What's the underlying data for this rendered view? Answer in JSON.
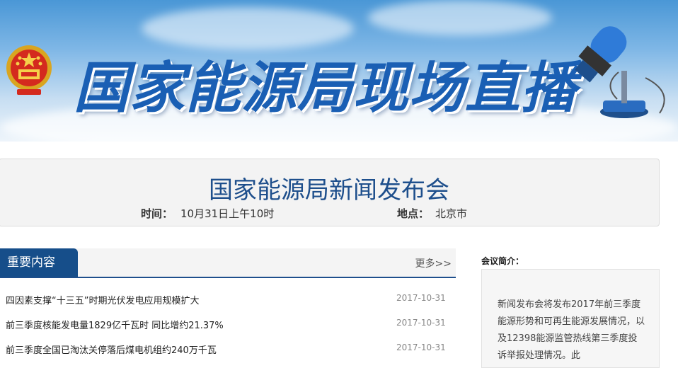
{
  "banner": {
    "title": "国家能源局现场直播",
    "emblem_icon": "national-emblem-icon",
    "mic_icon": "microphone-icon"
  },
  "press": {
    "title": "国家能源局新闻发布会",
    "time_label": "时间：",
    "time_value": "10月31日上午10时",
    "place_label": "地点：",
    "place_value": "北京市"
  },
  "key": {
    "tab_label": "重要内容",
    "more_label": "更多>>",
    "items": [
      {
        "title": "四因素支撑“十三五”时期光伏发电应用规模扩大",
        "date": "2017-10-31"
      },
      {
        "title": "前三季度核能发电量1829亿千瓦时 同比增约21.37%",
        "date": "2017-10-31"
      },
      {
        "title": "前三季度全国已淘汰关停落后煤电机组约240万千瓦",
        "date": "2017-10-31"
      }
    ]
  },
  "intro": {
    "label": "会议简介：",
    "text": "新闻发布会将发布2017年前三季度能源形势和可再生能源发展情况，以及12398能源监管热线第三季度投诉举报处理情况。此"
  },
  "colors": {
    "brand_blue": "#1e4f8c",
    "tab_blue": "#164e8a"
  }
}
